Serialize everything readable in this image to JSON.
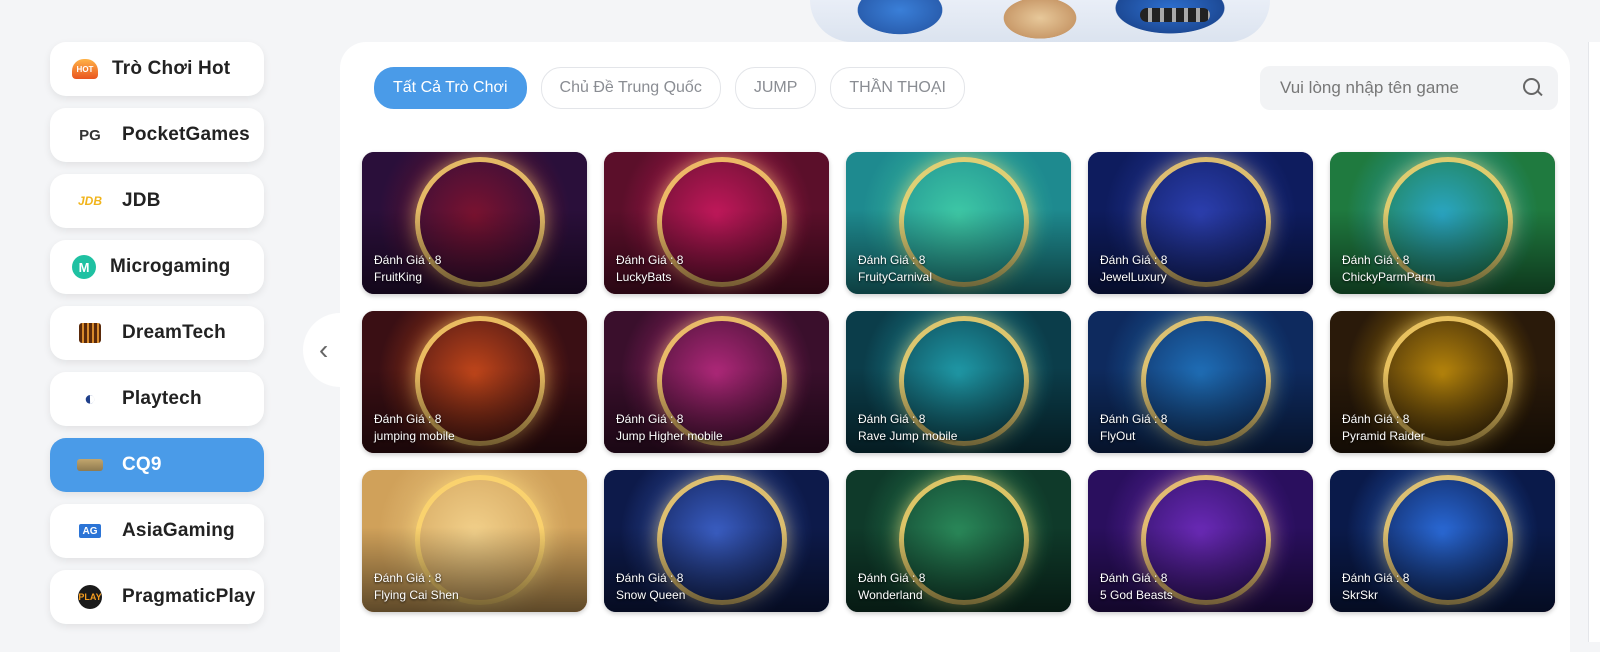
{
  "sidebar": {
    "items": [
      {
        "label": "Trò Chơi Hot",
        "icon": "hot-icon",
        "badge": "HOT"
      },
      {
        "label": "PocketGames",
        "icon": "pocketgames-logo-icon",
        "badge": "PG"
      },
      {
        "label": "JDB",
        "icon": "jdb-logo-icon",
        "badge": "JDB"
      },
      {
        "label": "Microgaming",
        "icon": "microgaming-logo-icon",
        "badge": "M"
      },
      {
        "label": "DreamTech",
        "icon": "dreamtech-logo-icon",
        "badge": ""
      },
      {
        "label": "Playtech",
        "icon": "playtech-logo-icon",
        "badge": "◐"
      },
      {
        "label": "CQ9",
        "icon": "cq9-logo-icon",
        "badge": "",
        "active": true
      },
      {
        "label": "AsiaGaming",
        "icon": "asiagaming-logo-icon",
        "badge": "AG"
      },
      {
        "label": "PragmaticPlay",
        "icon": "pragmaticplay-logo-icon",
        "badge": "PLAY"
      }
    ]
  },
  "tabs": [
    {
      "label": "Tất Cả Trò Chơi",
      "active": true
    },
    {
      "label": "Chủ Đề Trung Quốc",
      "active": false
    },
    {
      "label": "JUMP",
      "active": false
    },
    {
      "label": "THẦN THOẠI",
      "active": false
    }
  ],
  "search": {
    "placeholder": "Vui lòng nhập tên game",
    "value": ""
  },
  "nav": {
    "prev_arrow": "‹"
  },
  "games": [
    {
      "rating": "Đánh Giá : 8",
      "name": "FruitKing",
      "colors": [
        "#2a0f3a",
        "#7b1230",
        "#1a0b2e"
      ]
    },
    {
      "rating": "Đánh Giá : 8",
      "name": "LuckyBats",
      "colors": [
        "#5b0f2a",
        "#c2185b",
        "#3a0a52"
      ]
    },
    {
      "rating": "Đánh Giá : 8",
      "name": "FruityCarnival",
      "colors": [
        "#1e8a8f",
        "#3ec9a6",
        "#b8294b"
      ]
    },
    {
      "rating": "Đánh Giá : 8",
      "name": "JewelLuxury",
      "colors": [
        "#0e1c5e",
        "#2c3fb0",
        "#7a1f8f"
      ]
    },
    {
      "rating": "Đánh Giá : 8",
      "name": "ChickyParmParm",
      "colors": [
        "#1f7a3f",
        "#2aa6c4",
        "#d63c6b"
      ]
    },
    {
      "rating": "Đánh Giá : 8",
      "name": "jumping mobile",
      "colors": [
        "#3a0f14",
        "#c2461a",
        "#6b1c1c"
      ]
    },
    {
      "rating": "Đánh Giá : 8",
      "name": "Jump Higher mobile",
      "colors": [
        "#3a0f2c",
        "#b0287a",
        "#5a2a10"
      ]
    },
    {
      "rating": "Đánh Giá : 8",
      "name": "Rave Jump mobile",
      "colors": [
        "#0b3d4a",
        "#1f9aa8",
        "#5a1a8a"
      ]
    },
    {
      "rating": "Đánh Giá : 8",
      "name": "FlyOut",
      "colors": [
        "#0e2a5e",
        "#1f6fb8",
        "#8a1f9a"
      ]
    },
    {
      "rating": "Đánh Giá : 8",
      "name": "Pyramid Raider",
      "colors": [
        "#2a1a0a",
        "#b8860b",
        "#4a2a10"
      ]
    },
    {
      "rating": "Đánh Giá : 8",
      "name": "Flying Cai Shen",
      "colors": [
        "#d0a15a",
        "#f2d08a",
        "#a3311f"
      ]
    },
    {
      "rating": "Đánh Giá : 8",
      "name": "Snow Queen",
      "colors": [
        "#0d1a4a",
        "#3a5ec4",
        "#7fb8e8"
      ]
    },
    {
      "rating": "Đánh Giá : 8",
      "name": "Wonderland",
      "colors": [
        "#0f3a2a",
        "#2a8a5a",
        "#5a2a8a"
      ]
    },
    {
      "rating": "Đánh Giá : 8",
      "name": "5 God Beasts",
      "colors": [
        "#2a0f5e",
        "#6b2ab8",
        "#c48a1f"
      ]
    },
    {
      "rating": "Đánh Giá : 8",
      "name": "SkrSkr",
      "colors": [
        "#0a1a4a",
        "#2a6ad8",
        "#c41f1f"
      ]
    }
  ]
}
